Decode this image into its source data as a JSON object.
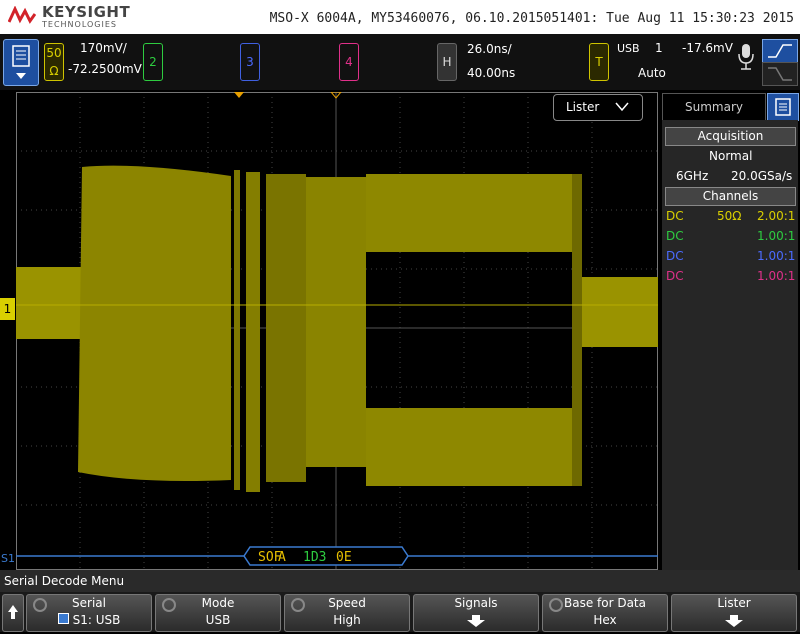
{
  "header": {
    "brand": "KEYSIGHT",
    "brand_sub": "TECHNOLOGIES",
    "instrument_info": "MSO-X 6004A, MY53460076, 06.10.2015051401: Tue Aug 11 15:30:23 2015"
  },
  "channels": {
    "ch1": {
      "impedance_top": "50",
      "impedance_bot": "Ω",
      "scale": "170mV/",
      "offset": "-72.2500mV",
      "color": "#d9cf00"
    },
    "ch2": {
      "label": "2",
      "color": "#2ecc40"
    },
    "ch3": {
      "label": "3",
      "color": "#4b6bff"
    },
    "ch4": {
      "label": "4",
      "color": "#e0308a"
    }
  },
  "horizontal": {
    "label": "H",
    "scale": "26.0ns/",
    "delay": "40.00ns"
  },
  "trigger": {
    "label": "T",
    "source": "USB",
    "channel": "1",
    "level": "-17.6mV",
    "mode": "Auto"
  },
  "screen": {
    "ch1_marker": "1",
    "serial_marker": "S1",
    "lister_label": "Lister",
    "decode_packet": [
      "SOF",
      "A",
      "1D3",
      "0E"
    ]
  },
  "side_panel": {
    "tab_label": "Summary",
    "acquisition_title": "Acquisition",
    "acq_mode": "Normal",
    "bandwidth": "6GHz",
    "sample_rate": "20.0GSa/s",
    "channels_title": "Channels",
    "channel_rows": [
      {
        "coupling": "DC",
        "impedance": "50Ω",
        "probe": "2.00:1",
        "color": "#d9cf00"
      },
      {
        "coupling": "DC",
        "impedance": "",
        "probe": "1.00:1",
        "color": "#2ecc40"
      },
      {
        "coupling": "DC",
        "impedance": "",
        "probe": "1.00:1",
        "color": "#4b6bff"
      },
      {
        "coupling": "DC",
        "impedance": "",
        "probe": "1.00:1",
        "color": "#e0308a"
      }
    ]
  },
  "menu": {
    "title": "Serial Decode Menu",
    "softkeys": [
      {
        "top": "Serial",
        "bottom": "S1: USB"
      },
      {
        "top": "Mode",
        "bottom": "USB"
      },
      {
        "top": "Speed",
        "bottom": "High"
      },
      {
        "top": "Signals",
        "bottom": ""
      },
      {
        "top": "Base for Data",
        "bottom": "Hex"
      },
      {
        "top": "Lister",
        "bottom": ""
      }
    ]
  }
}
